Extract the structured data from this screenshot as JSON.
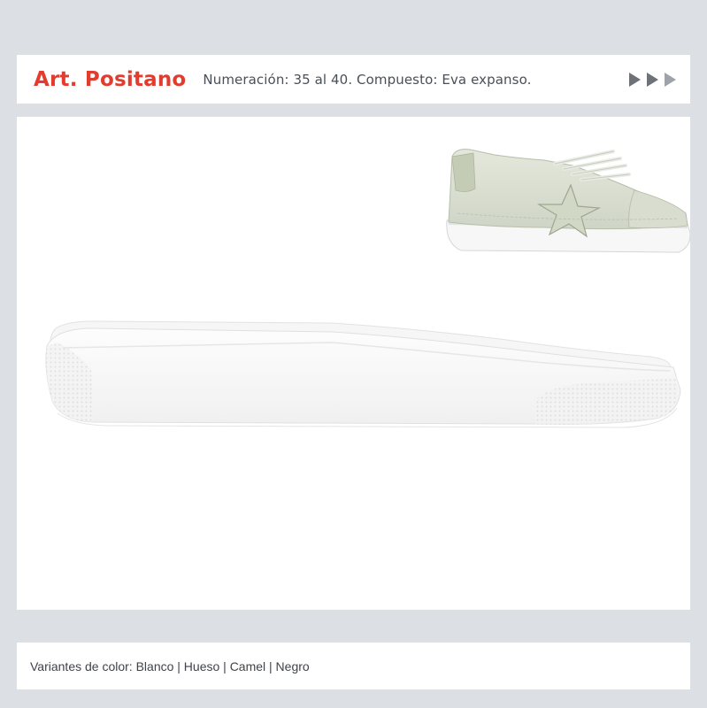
{
  "header": {
    "title": "Art. Positano",
    "subtitle": "Numeración: 35 al 40. Compuesto: Eva expanso."
  },
  "footer": {
    "variants": "Variantes de color: Blanco | Hueso | Camel | Negro"
  },
  "colors": {
    "background": "#dcdfe3",
    "title_red": "#e23c2e",
    "text_gray": "#4a4f57",
    "arrow_dark": "#6d7178",
    "arrow_light": "#9ea3a9"
  },
  "icons": [
    "next-arrow-icon",
    "next-arrow-icon",
    "next-arrow-icon"
  ]
}
